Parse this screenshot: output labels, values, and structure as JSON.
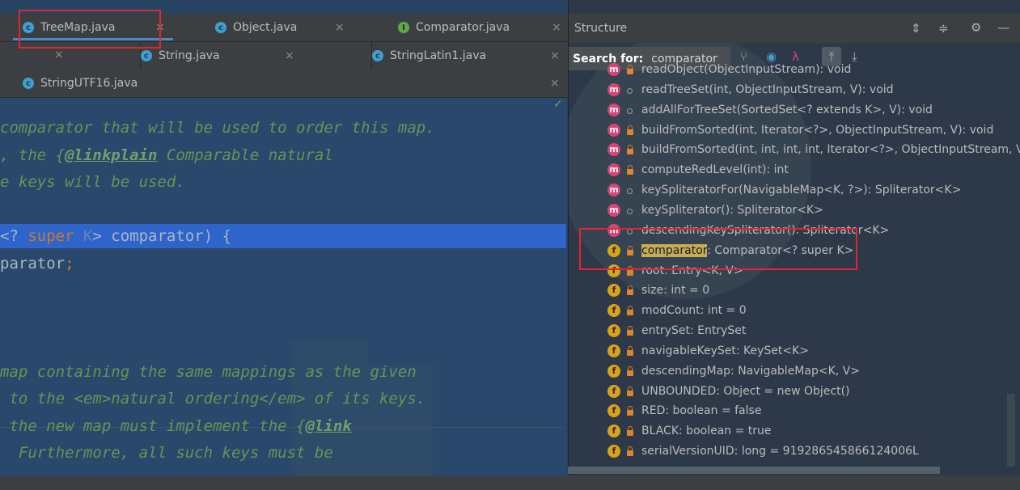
{
  "editor": {
    "tabs_row1": [
      {
        "label": "TreeMap.java",
        "icon": "class-icon"
      },
      {
        "label": "Object.java",
        "icon": "class-icon"
      },
      {
        "label": "Comparator.java",
        "icon": "interface-icon"
      }
    ],
    "tabs_row2": [
      {
        "label": "String.java",
        "icon": "class-icon"
      },
      {
        "label": "StringLatin1.java",
        "icon": "class-icon"
      }
    ],
    "tabs_row3": [
      {
        "label": "StringUTF16.java",
        "icon": "class-icon"
      }
    ],
    "icon_letters": {
      "class": "c",
      "interface": "I"
    },
    "close_glyph": "×",
    "code": {
      "l1": "comparator that will be used to order this map.",
      "l2a": ", the {",
      "l2b": "@linkplain",
      "l2c": " Comparable natural",
      "l3": "e keys will be used.",
      "l4a": "<? ",
      "l4b": "super",
      "l4c": " K",
      "l4d": "> comparator) {",
      "l5a": "parator",
      "l5b": ";",
      "l6": "map containing the same mappings as the given",
      "l7": " to the <em>natural ordering</em> of its keys.",
      "l8a": " the new map must implement the {",
      "l8b": "@link",
      "l9": "  Furthermore, all such keys must be"
    }
  },
  "structure": {
    "title": "Structure",
    "search_label": "Search for:",
    "search_value": "comparator",
    "highlight": "comparator",
    "items": [
      {
        "kind": "m",
        "vis": "lock",
        "text": "readObject(ObjectInputStream): void"
      },
      {
        "kind": "m",
        "vis": "dot",
        "text": "readTreeSet(int, ObjectInputStream, V): void"
      },
      {
        "kind": "m",
        "vis": "dot",
        "text": "addAllForTreeSet(SortedSet<? extends K>, V): void"
      },
      {
        "kind": "m",
        "vis": "lock",
        "text": "buildFromSorted(int, Iterator<?>, ObjectInputStream, V): void"
      },
      {
        "kind": "m",
        "vis": "lock",
        "text": "buildFromSorted(int, int, int, int, Iterator<?>, ObjectInputStream, V): E"
      },
      {
        "kind": "m",
        "vis": "lock",
        "text": "computeRedLevel(int): int"
      },
      {
        "kind": "m",
        "vis": "dot",
        "text": "keySpliteratorFor(NavigableMap<K, ?>): Spliterator<K>"
      },
      {
        "kind": "m",
        "vis": "dot",
        "text": "keySpliterator(): Spliterator<K>"
      },
      {
        "kind": "m",
        "vis": "dot",
        "text": "descendingKeySpliterator(): Spliterator<K>"
      },
      {
        "kind": "f",
        "vis": "lock",
        "text": "comparator: Comparator<? super K>"
      },
      {
        "kind": "f",
        "vis": "lock",
        "text": "root: Entry<K, V>"
      },
      {
        "kind": "f",
        "vis": "lock",
        "text": "size: int = 0"
      },
      {
        "kind": "f",
        "vis": "lock",
        "text": "modCount: int = 0"
      },
      {
        "kind": "f",
        "vis": "lock",
        "text": "entrySet: EntrySet"
      },
      {
        "kind": "f",
        "vis": "lock",
        "text": "navigableKeySet: KeySet<K>"
      },
      {
        "kind": "f",
        "vis": "lock",
        "text": "descendingMap: NavigableMap<K, V>"
      },
      {
        "kind": "f",
        "vis": "lock",
        "text": "UNBOUNDED: Object = new Object()"
      },
      {
        "kind": "f",
        "vis": "lock",
        "text": "RED: boolean = false"
      },
      {
        "kind": "f",
        "vis": "lock",
        "text": "BLACK: boolean = true"
      },
      {
        "kind": "f",
        "vis": "lock",
        "text": "serialVersionUID: long = 919286545866124006L"
      }
    ]
  },
  "colors": {
    "accent": "#4a88c7",
    "annotation_box": "#e2262f",
    "selection": "#2f65ca"
  }
}
